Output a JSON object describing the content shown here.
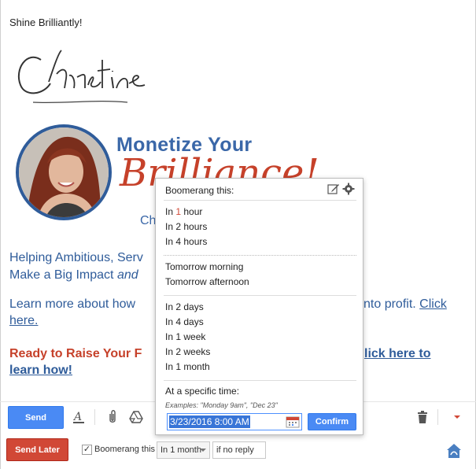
{
  "email": {
    "signoff": "Shine Brilliantly!",
    "signature_name": "Christine",
    "brand": {
      "line1": "Monetize Your",
      "line2": "Brilliance!",
      "line3": "Ch"
    },
    "para1_line1": "Helping Ambitious, Serv",
    "para1_line2_a": "Make a Big Impact ",
    "para1_line2_b": "and",
    "para2_a": "Learn more about how",
    "para2_b": "nto profit. ",
    "para2_link1": "Click",
    "para2_link2": "here.",
    "cta_a": "Ready to Raise Your F",
    "cta_link1": "lick here to",
    "cta_link2": "learn how!"
  },
  "toolbar": {
    "send_label": "Send",
    "send_later_label": "Send Later",
    "boomerang_checked": true,
    "boomerang_label": "Boomerang this",
    "boomerang_select": "In 1 month",
    "noreply_select": "if no reply",
    "icons": [
      "text-format-icon",
      "attach-icon",
      "drive-icon",
      "trash-icon",
      "more-options-icon",
      "boomerang-logo-icon"
    ]
  },
  "popup": {
    "title": "Boomerang this:",
    "group1": [
      {
        "pre": "In ",
        "hl": "1",
        "post": " hour"
      },
      {
        "pre": "In 2 hours",
        "hl": "",
        "post": ""
      },
      {
        "pre": "In 4 hours",
        "hl": "",
        "post": ""
      }
    ],
    "group2": [
      "Tomorrow morning",
      "Tomorrow afternoon"
    ],
    "group3": [
      "In 2 days",
      "In 4 days",
      "In 1 week",
      "In 2 weeks",
      "In 1 month"
    ],
    "specific_label": "At a specific time:",
    "examples": "Examples: \"Monday 9am\", \"Dec 23\"",
    "datetime_value": "3/23/2016 8:00 AM",
    "confirm_label": "Confirm"
  },
  "colors": {
    "accent_blue": "#4a8af4",
    "send_later_red": "#d14836",
    "brand_blue": "#3a67a8",
    "brand_red": "#c6412a"
  }
}
